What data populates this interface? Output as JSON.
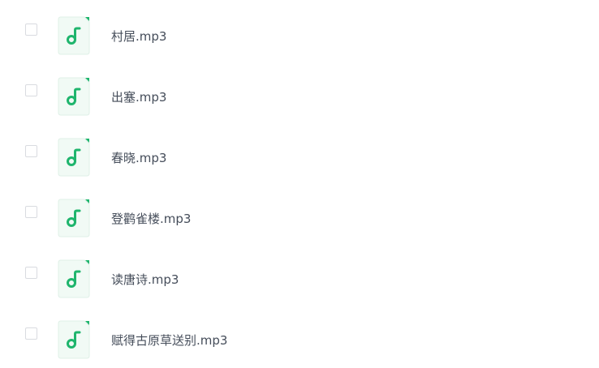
{
  "colors": {
    "accent": "#1fb56d",
    "icon_bg": "#f1faf5",
    "icon_border": "#dff0e7",
    "text": "#454d5a",
    "checkbox_border": "#d9dbe0"
  },
  "files": [
    {
      "name": "村居.mp3",
      "icon": "music-note-icon",
      "checked": false
    },
    {
      "name": "出塞.mp3",
      "icon": "music-note-icon",
      "checked": false
    },
    {
      "name": "春晓.mp3",
      "icon": "music-note-icon",
      "checked": false
    },
    {
      "name": "登鹳雀楼.mp3",
      "icon": "music-note-icon",
      "checked": false
    },
    {
      "name": "读唐诗.mp3",
      "icon": "music-note-icon",
      "checked": false
    },
    {
      "name": "赋得古原草送别.mp3",
      "icon": "music-note-icon",
      "checked": false
    }
  ]
}
